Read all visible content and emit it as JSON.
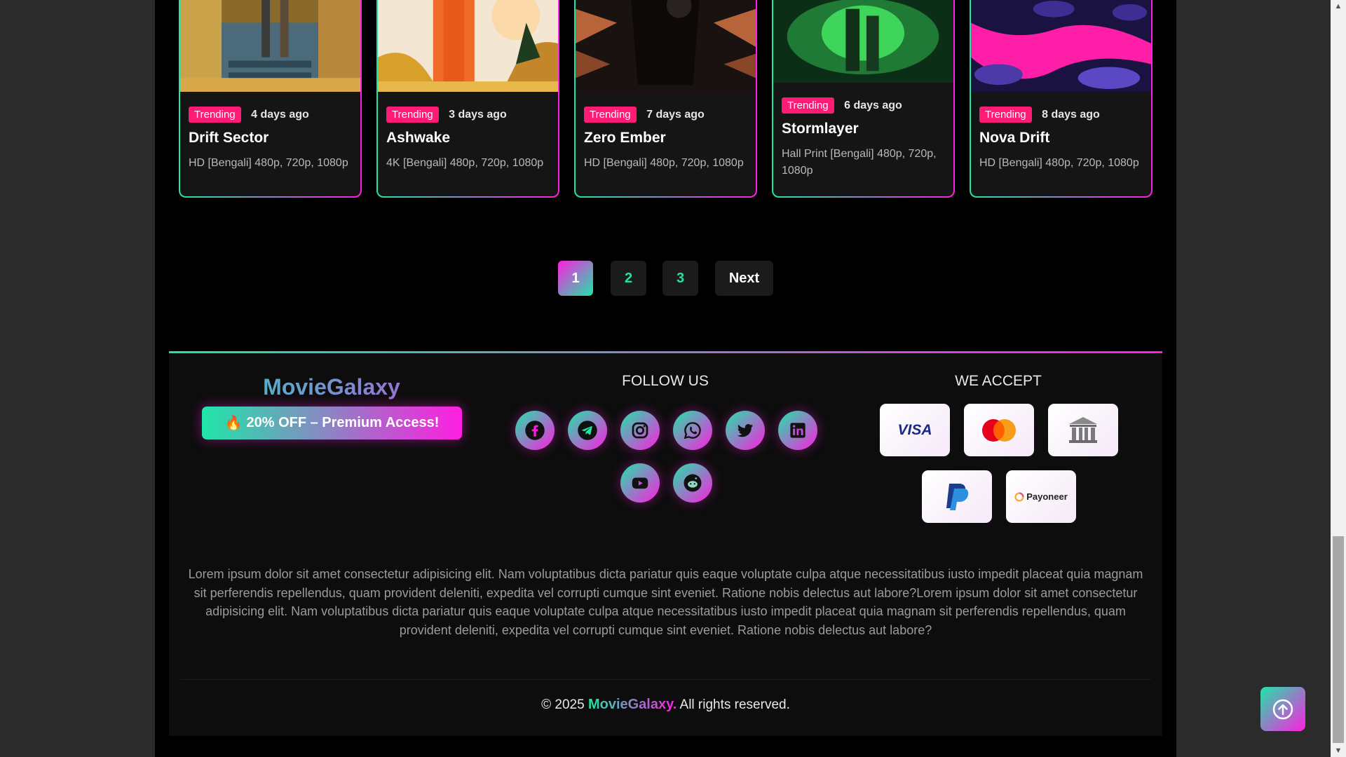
{
  "cards": [
    {
      "badge": "Trending",
      "ago": "4 days ago",
      "title": "Drift Sector",
      "desc": "HD [Bengali] 480p, 720p, 1080p"
    },
    {
      "badge": "Trending",
      "ago": "3 days ago",
      "title": "Ashwake",
      "desc": "4K [Bengali] 480p, 720p, 1080p"
    },
    {
      "badge": "Trending",
      "ago": "7 days ago",
      "title": "Zero Ember",
      "desc": "HD [Bengali] 480p, 720p, 1080p"
    },
    {
      "badge": "Trending",
      "ago": "6 days ago",
      "title": "Stormlayer",
      "desc": "Hall Print [Bengali] 480p, 720p, 1080p"
    },
    {
      "badge": "Trending",
      "ago": "8 days ago",
      "title": "Nova Drift",
      "desc": "HD [Bengali] 480p, 720p, 1080p"
    }
  ],
  "pagination": {
    "pages": [
      "1",
      "2",
      "3"
    ],
    "active": "1",
    "next_label": "Next"
  },
  "footer": {
    "brand": "MovieGalaxy",
    "promo": "20% OFF – Premium Access!",
    "promo_icon": "fire-icon",
    "follow_title": "FOLLOW US",
    "socials": [
      "facebook",
      "telegram",
      "instagram",
      "whatsapp",
      "twitter",
      "linkedin",
      "youtube",
      "reddit"
    ],
    "accept_title": "WE ACCEPT",
    "payments": [
      "VISA",
      "MasterCard",
      "Bank",
      "PayPal",
      "Payoneer"
    ],
    "lorem": "Lorem ipsum dolor sit amet consectetur adipisicing elit. Nam voluptatibus dicta pariatur quis eaque voluptate culpa atque necessitatibus iusto impedit placeat quia magnam sit perferendis repellendus, quam provident deleniti, expedita vel corrupti cumque sint eveniet. Ratione nobis delectus aut labore?Lorem ipsum dolor sit amet consectetur adipisicing elit. Nam voluptatibus dicta pariatur quis eaque voluptate culpa atque necessitatibus iusto impedit placeat quia magnam sit perferendis repellendus, quam provident deleniti, expedita vel corrupti cumque sint eveniet. Ratione nobis delectus aut labore?",
    "copyright_prefix": "© 2025 ",
    "copyright_brand": "MovieGalaxy.",
    "copyright_suffix": " All rights reserved."
  },
  "colors": {
    "accent_green": "#1fe6a8",
    "accent_pink": "#ff1ee0",
    "badge": "#ff1a75"
  }
}
